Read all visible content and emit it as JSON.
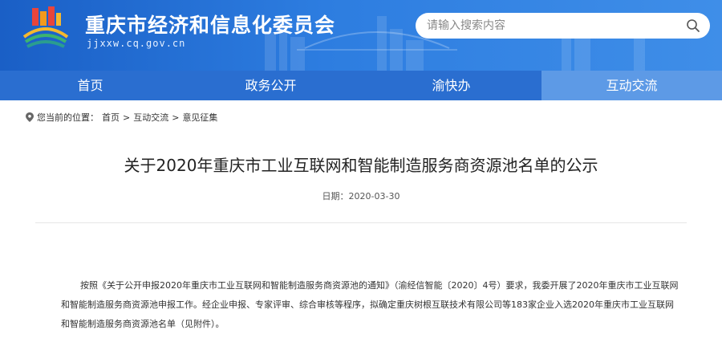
{
  "header": {
    "site_title": "重庆市经济和信息化委员会",
    "site_domain": "jjxxw.cq.gov.cn",
    "search_placeholder": "请输入搜索内容"
  },
  "nav": {
    "items": [
      {
        "label": "首页"
      },
      {
        "label": "政务公开"
      },
      {
        "label": "渝快办"
      },
      {
        "label": "互动交流"
      }
    ],
    "active_index": 3
  },
  "breadcrumb": {
    "prefix": "您当前的位置：",
    "items": [
      "首页",
      "互动交流",
      "意见征集"
    ],
    "separator": ">"
  },
  "article": {
    "title": "关于2020年重庆市工业互联网和智能制造服务商资源池名单的公示",
    "date_label": "日期：",
    "date": "2020-03-30",
    "body": "按照《关于公开申报2020年重庆市工业互联网和智能制造服务商资源池的通知》（渝经信智能〔2020〕4号）要求，我委开展了2020年重庆市工业互联网和智能制造服务商资源池申报工作。经企业申报、专家评审、综合审核等程序，拟确定重庆树根互联技术有限公司等183家企业入选2020年重庆市工业互联网和智能制造服务商资源池名单（见附件）。"
  },
  "colors": {
    "header_blue": "#1a5fc6",
    "nav_blue": "#2a6ed0",
    "nav_active": "#5d9ae6"
  }
}
